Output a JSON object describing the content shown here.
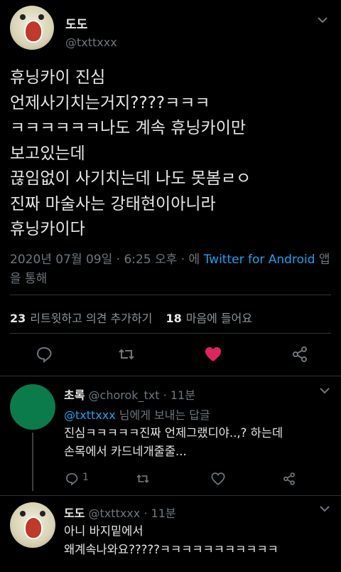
{
  "tweet": {
    "display_name": "도도",
    "handle": "@txttxxx",
    "text": "휴닝카이 진심\n언제사기치는거지????ㅋㅋㅋ\nㅋㅋㅋㅋㅋㅋ나도 계속 휴닝카이만\n보고있는데\n끊임없이 사기치는데 나도 못봄ㄹㅇ\n진짜 마술사는 강태현이아니라\n휴닝카이다",
    "timestamp": "2020년 07월 09일 · 6:25 오후 · 에",
    "source": "Twitter for Android",
    "source_suffix": "앱을 통해",
    "retweet_count": "23",
    "retweet_label": "리트윗하고 의견 추가하기",
    "like_count": "18",
    "like_label": "마음에 들어요"
  },
  "replies": [
    {
      "display_name": "초록",
      "handle": "@chorok_txt",
      "time": "· 11분",
      "reply_to_handle": "@txttxxx",
      "reply_to_suffix": "님에게 보내는 답글",
      "text": "진심ㅋㅋㅋㅋㅋ진짜 언제그랬디야..,? 하는데\n손목에서 카드네개줄줄...",
      "reply_count": "1",
      "avatar_color": "#0b7b4b"
    },
    {
      "display_name": "도도",
      "handle": "@txttxxx",
      "time": "· 11분",
      "text": "아니 바지밑에서\n왜계속나와요?????ㅋㅋㅋㅋㅋㅋㅋㅋㅋㅋㅋ"
    }
  ],
  "colors": {
    "background": "#000000",
    "accent": "#1da1f2",
    "like_active": "#e0245e",
    "muted": "#6e767d"
  }
}
